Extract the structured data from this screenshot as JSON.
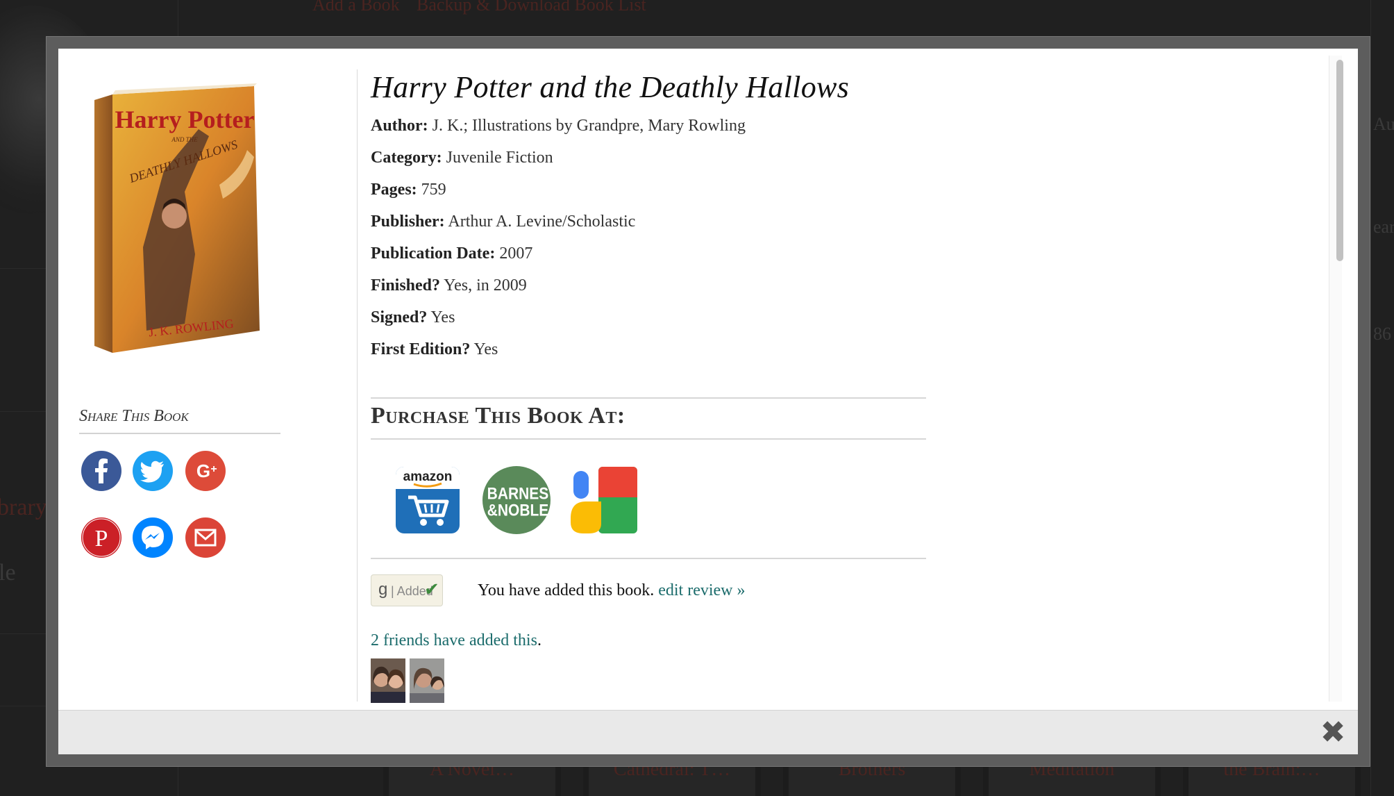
{
  "background": {
    "top_links": [
      "Add a Book",
      "Backup & Download Book List"
    ],
    "left_fragments": [
      "brary",
      "le"
    ],
    "right_fragments": [
      "Au",
      "ear",
      "86"
    ],
    "bottom_tiles": [
      "A Novel…",
      "Cathedral: T…",
      "Brothers",
      "Meditation",
      "the Brain:…"
    ]
  },
  "book": {
    "title": "Harry Potter and the Deathly Hallows",
    "cover_alt": "Harry Potter and the Deathly Hallows",
    "cover_text": {
      "title_line1": "Harry Potter",
      "subtitle_and": "AND THE",
      "subtitle": "DEATHLY HALLOWS",
      "author": "J. K. ROWLING"
    },
    "details": [
      {
        "label": "Author:",
        "value": "J. K.; Illustrations by Grandpre, Mary Rowling"
      },
      {
        "label": "Category:",
        "value": "Juvenile Fiction"
      },
      {
        "label": "Pages:",
        "value": "759"
      },
      {
        "label": "Publisher:",
        "value": "Arthur A. Levine/Scholastic"
      },
      {
        "label": "Publication Date:",
        "value": "2007"
      },
      {
        "label": "Finished?",
        "value": "Yes, in 2009"
      },
      {
        "label": "Signed?",
        "value": "Yes"
      },
      {
        "label": "First Edition?",
        "value": "Yes"
      }
    ]
  },
  "share": {
    "heading": "Share This Book",
    "buttons": [
      {
        "name": "facebook",
        "icon": "facebook-icon",
        "color": "#3b5998"
      },
      {
        "name": "twitter",
        "icon": "twitter-icon",
        "color": "#1da1f2"
      },
      {
        "name": "google-plus",
        "icon": "google-plus-icon",
        "color": "#dd4b39"
      },
      {
        "name": "pinterest",
        "icon": "pinterest-icon",
        "color": "#cb2027"
      },
      {
        "name": "messenger",
        "icon": "messenger-icon",
        "color": "#0084ff"
      },
      {
        "name": "gmail",
        "icon": "gmail-icon",
        "color": "#db4437"
      }
    ]
  },
  "purchase": {
    "heading": "Purchase This Book At:",
    "stores": [
      {
        "name": "amazon",
        "label": "amazon",
        "icon": "amazon-cart-icon"
      },
      {
        "name": "barnes-noble",
        "label_line1": "BARNES",
        "label_line2": "&NOBLE",
        "icon": "barnes-noble-icon",
        "color": "#5a8a5a"
      },
      {
        "name": "google",
        "icon": "google-logo-icon"
      }
    ]
  },
  "goodreads": {
    "badge_g": "g",
    "badge_label": "| Added",
    "added_text": "You have added this book.",
    "edit_review": "edit review »",
    "friends_link": "2 friends have added this",
    "friends_suffix": "."
  },
  "colors": {
    "link": "#1a6b6b",
    "overlay": "#1b1b1b",
    "footer": "#e9e9e9"
  }
}
